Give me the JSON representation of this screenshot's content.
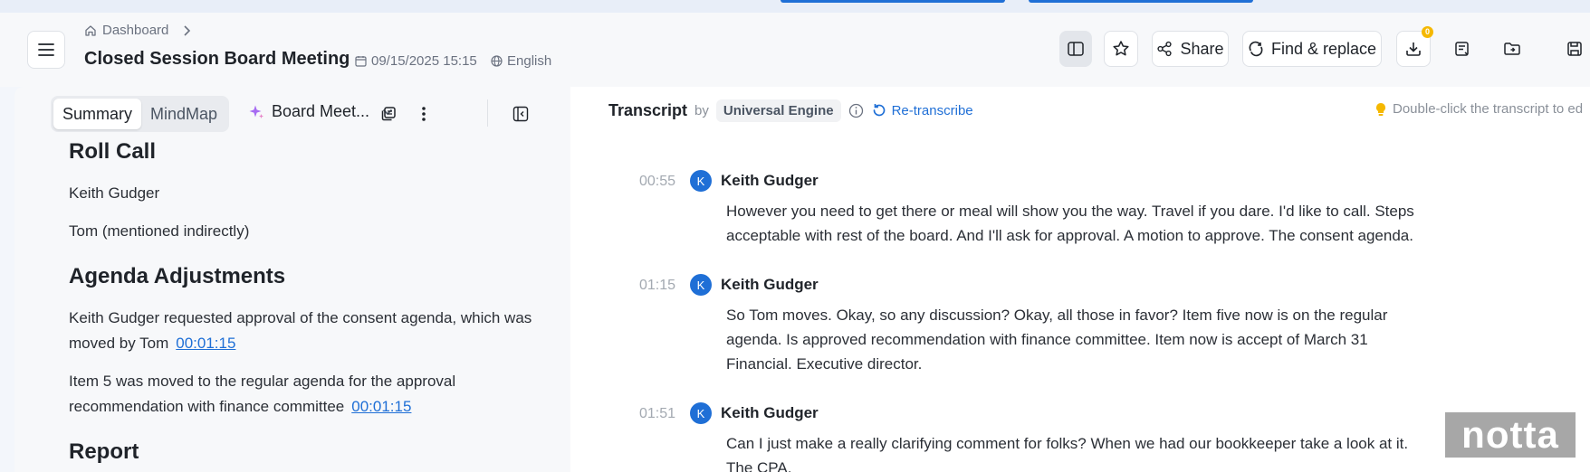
{
  "header": {
    "breadcrumb": "Dashboard",
    "title": "Closed Session Board Meeting",
    "datetime": "09/15/2025 15:15",
    "language": "English",
    "share_label": "Share",
    "find_replace_label": "Find & replace",
    "download_badge": "0"
  },
  "summary_panel": {
    "tabs": [
      "Summary",
      "MindMap"
    ],
    "active_tab": "Summary",
    "template_label": "Board Meet...",
    "sections": [
      {
        "heading": "Roll Call",
        "items": [
          {
            "text": "Keith Gudger"
          },
          {
            "text": "Tom (mentioned indirectly)"
          }
        ]
      },
      {
        "heading": "Agenda Adjustments",
        "items": [
          {
            "text": "Keith Gudger requested approval of the consent agenda, which was moved by Tom",
            "timestamp": "00:01:15"
          },
          {
            "text": "Item 5 was moved to the regular agenda for the approval recommendation with finance committee",
            "timestamp": "00:01:15"
          }
        ]
      },
      {
        "heading": "Report"
      }
    ]
  },
  "transcript": {
    "label": "Transcript",
    "by": "by",
    "engine": "Universal Engine",
    "retranscribe": "Re-transcribe",
    "hint": "Double-click the transcript to ed",
    "utterances": [
      {
        "time": "00:55",
        "initial": "K",
        "speaker": "Keith Gudger",
        "text": "However you need to get there or meal will show you the way. Travel if you dare. I'd like to call. Steps acceptable with rest of the board. And I'll ask for approval. A motion to approve. The consent agenda."
      },
      {
        "time": "01:15",
        "initial": "K",
        "speaker": "Keith Gudger",
        "text": "So Tom moves. Okay, so any discussion? Okay, all those in favor? Item five now is on the regular agenda. Is approved recommendation with finance committee. Item now is accept of March 31 Financial. Executive director."
      },
      {
        "time": "01:51",
        "initial": "K",
        "speaker": "Keith Gudger",
        "text": "Can I just make a really clarifying comment for folks? When we had our bookkeeper take a look at it. The CPA,"
      }
    ]
  },
  "watermark": "notta",
  "colors": {
    "accent": "#1f6fd6",
    "badge": "#f5b800"
  }
}
